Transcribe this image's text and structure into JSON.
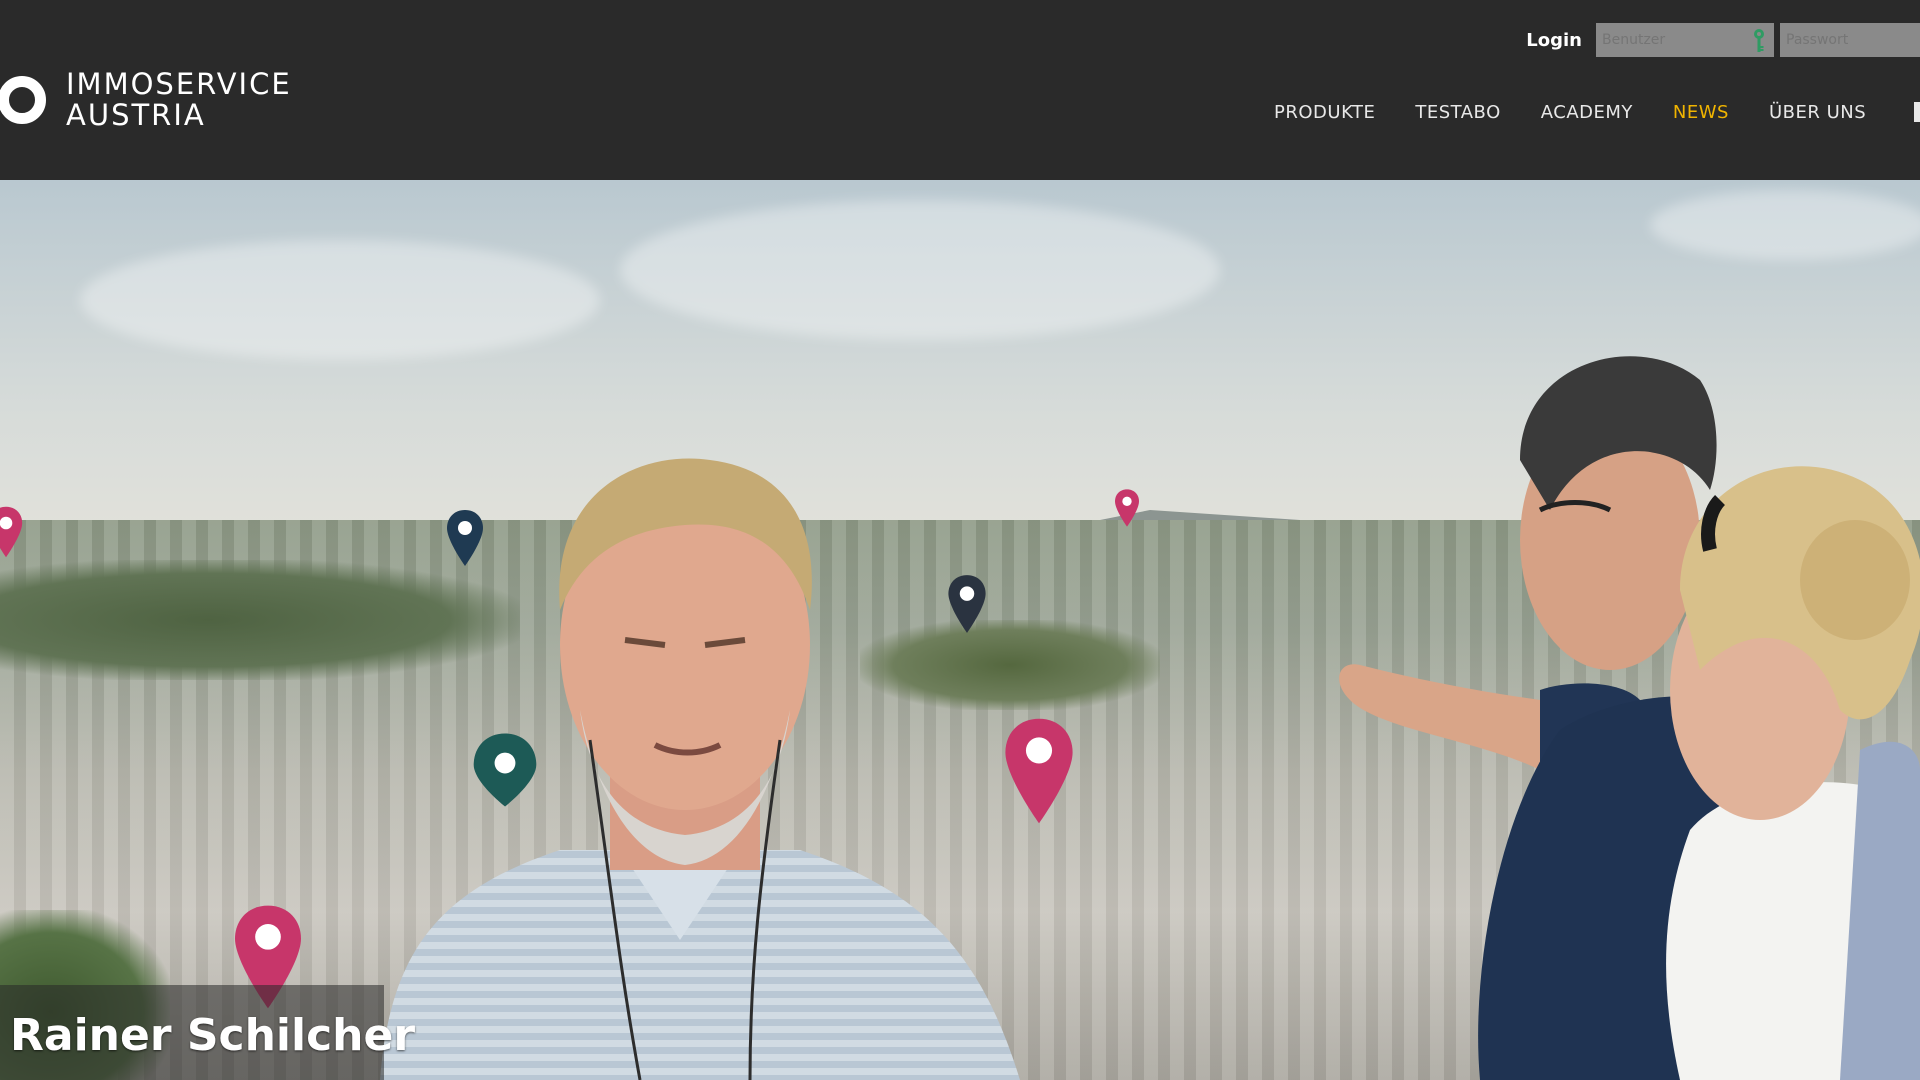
{
  "header": {
    "logo_line1": "IMMOSERVICE",
    "logo_line2": "AUSTRIA",
    "login_label": "Login",
    "username_placeholder": "Benutzer",
    "password_placeholder": "Passwort"
  },
  "nav": {
    "items": [
      {
        "label": "PRODUKTE",
        "active": false
      },
      {
        "label": "TESTABO",
        "active": false
      },
      {
        "label": "ACADEMY",
        "active": false
      },
      {
        "label": "NEWS",
        "active": true
      },
      {
        "label": "ÜBER UNS",
        "active": false
      }
    ],
    "active_color": "#f0b400"
  },
  "participant": {
    "name": "Rainer Schilcher"
  },
  "icons": {
    "logo": "ring-logo-icon",
    "key": "key-icon",
    "pin": "map-pin-icon"
  },
  "colors": {
    "header_bg": "#2a2a2a",
    "pin_pink": "#c7366a",
    "pin_navy": "#1f3a52",
    "pin_teal": "#1d5a56",
    "pin_dark": "#2a3340"
  }
}
